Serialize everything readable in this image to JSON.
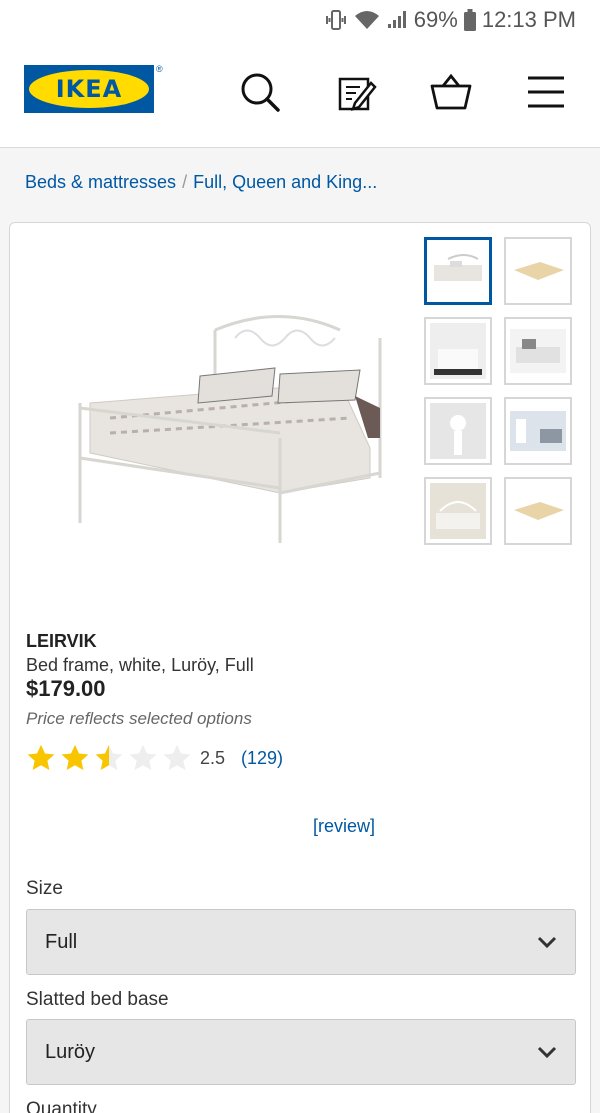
{
  "status_bar": {
    "battery": "69%",
    "time": "12:13 PM"
  },
  "header": {
    "logo_text": "IKEA",
    "icons": [
      "search-icon",
      "shopping-list-icon",
      "cart-icon",
      "menu-icon"
    ]
  },
  "breadcrumb": {
    "items": [
      "Beds & mattresses",
      "Full, Queen and King..."
    ],
    "separator": "/"
  },
  "product": {
    "name": "LEIRVIK",
    "description": "Bed frame, white, Luröy, Full",
    "price": "$179.00",
    "price_note": "Price reflects selected options",
    "rating": {
      "value": "2.5",
      "count": "(129)",
      "stars_filled": 2.5,
      "stars_total": 5
    },
    "review_link": "[review]"
  },
  "options": {
    "size": {
      "label": "Size",
      "value": "Full"
    },
    "base": {
      "label": "Slatted bed base",
      "value": "Luröy"
    },
    "quantity": {
      "label": "Quantity"
    }
  },
  "colors": {
    "brand_blue": "#0058a3",
    "brand_yellow": "#ffdb00",
    "star": "#f7c600"
  }
}
